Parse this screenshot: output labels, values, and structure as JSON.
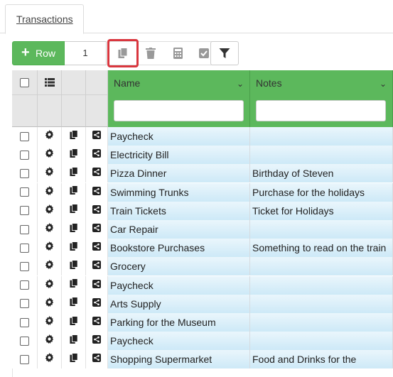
{
  "tab": {
    "label": "Transactions"
  },
  "toolbar": {
    "add_row_label": "Row",
    "add_row_icon": "plus-icon",
    "row_count_value": "1",
    "buttons": [
      "copy-icon",
      "trash-icon",
      "calculator-icon",
      "check-icon",
      "filter-icon"
    ],
    "highlight_color": "#d9363e",
    "accent_color": "#5cb85c"
  },
  "grid": {
    "columns": [
      {
        "label": "Name",
        "filter_value": ""
      },
      {
        "label": "Notes",
        "filter_value": ""
      }
    ],
    "header_color": "#5cb85c",
    "rows": [
      {
        "name": "Paycheck",
        "notes": ""
      },
      {
        "name": "Electricity Bill",
        "notes": ""
      },
      {
        "name": "Pizza Dinner",
        "notes": "Birthday of Steven"
      },
      {
        "name": "Swimming Trunks",
        "notes": "Purchase for the holidays"
      },
      {
        "name": "Train Tickets",
        "notes": "Ticket for Holidays"
      },
      {
        "name": "Car Repair",
        "notes": ""
      },
      {
        "name": "Bookstore Purchases",
        "notes": "Something to read on the train"
      },
      {
        "name": "Grocery",
        "notes": ""
      },
      {
        "name": "Paycheck",
        "notes": ""
      },
      {
        "name": "Arts Supply",
        "notes": ""
      },
      {
        "name": "Parking for the Museum",
        "notes": ""
      },
      {
        "name": "Paycheck",
        "notes": ""
      },
      {
        "name": "Shopping Supermarket",
        "notes": "Food and Drinks for the"
      }
    ]
  }
}
